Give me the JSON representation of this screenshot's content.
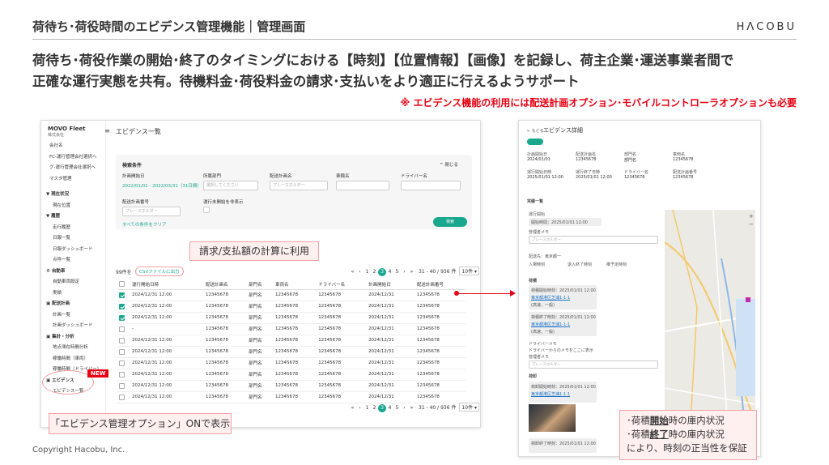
{
  "slide": {
    "title": "荷待ち･荷役時間のエビデンス管理機能｜管理画面",
    "logo": "HΛCOBU",
    "headline_line1": "荷待ち･荷役作業の開始･終了のタイミングにおける【時刻】【位置情報】【画像】を記録し、荷主企業･運送事業者間で",
    "headline_line2": "正確な運行実態を共有。待機料金･荷役料金の請求･支払いをより適正に行えるようサポート",
    "note": "※ エビデンス機能の利用には配送計画オプション･モバイルコントローラオプションも必要",
    "copyright": "Copyright Hacobu, Inc."
  },
  "app": {
    "brand": "MOVO Fleet",
    "brand_sub": "株式会社",
    "page_title": "エビデンス一覧",
    "sidebar": [
      {
        "label": "会社名",
        "kind": "item"
      },
      {
        "label": "FC-運行管理会社選択へ",
        "kind": "item"
      },
      {
        "label": "グ-運行管理会社選択へ",
        "kind": "item"
      },
      {
        "label": "マスタ管理",
        "kind": "item"
      },
      {
        "label": "",
        "kind": "gap"
      },
      {
        "label": "▼ 現在状況",
        "kind": "sec"
      },
      {
        "label": "現在位置",
        "kind": "sub"
      },
      {
        "label": "▼ 履歴",
        "kind": "sec"
      },
      {
        "label": "走行履歴",
        "kind": "sub"
      },
      {
        "label": "日報一覧",
        "kind": "sub"
      },
      {
        "label": "日報ダッシュボード",
        "kind": "sub"
      },
      {
        "label": "点呼一覧",
        "kind": "sub"
      },
      {
        "label": "⚙ 自動車",
        "kind": "sec"
      },
      {
        "label": "自動車両設定",
        "kind": "sub"
      },
      {
        "label": "実績",
        "kind": "sub"
      },
      {
        "label": "▣ 配送計画",
        "kind": "sec"
      },
      {
        "label": "計画一覧",
        "kind": "sub"
      },
      {
        "label": "計画ダッシュボード",
        "kind": "sub"
      },
      {
        "label": "▣ 集計・分析",
        "kind": "sec"
      },
      {
        "label": "地点滞在時間分析",
        "kind": "sub"
      },
      {
        "label": "稼働時間（車両）",
        "kind": "sub"
      },
      {
        "label": "稼働時間（ドライバー）",
        "kind": "sub"
      },
      {
        "label": "▣ エビデンス",
        "kind": "sec"
      },
      {
        "label": "エビデンス一覧",
        "kind": "sub"
      }
    ],
    "filter": {
      "heading": "検索条件",
      "close_label": "^ 閉じる",
      "labels": {
        "period": "計画開始日",
        "dept": "所属部門",
        "plan": "配送計画名",
        "vehicle": "車輌名",
        "driver": "ドライバー名",
        "plan_no": "配送計画番号",
        "hide": "運行未開始を非表示"
      },
      "period_value": "2022/01/01 - 2022/03/31（31日間）",
      "dept_placeholder": "選択してください",
      "plan_placeholder": "プレースホルダー",
      "plan_no_placeholder": "プレースホルダー",
      "clear_label": "すべての条件をクリア",
      "search_button": "検索"
    },
    "count": "99件を",
    "csv_label": "CSVファイルに出力",
    "pager": {
      "pages": [
        "«",
        "‹",
        "1",
        "2",
        "3",
        "4",
        "5",
        "›",
        "»"
      ],
      "current": "3",
      "range": "31 - 40 / 936 件",
      "per_page": "10件 ▾"
    },
    "table": {
      "headers": [
        "",
        "運行開始日時",
        "配送計画名",
        "部門名",
        "車両名",
        "ドライバー名",
        "計画開始日",
        "配送計画番号"
      ],
      "rows": [
        {
          "checked": true,
          "cells": [
            "2024/12/31 12:00",
            "12345678",
            "部門名",
            "12345678",
            "12345678",
            "2024/12/31",
            "12345678"
          ]
        },
        {
          "checked": true,
          "cells": [
            "2024/12/31 12:00",
            "12345678",
            "部門名",
            "12345678",
            "12345678",
            "2024/12/31",
            "12345678"
          ]
        },
        {
          "checked": true,
          "cells": [
            "2024/12/31 12:00",
            "12345678",
            "部門名",
            "12345678",
            "12345678",
            "2024/12/31",
            "12345678"
          ]
        },
        {
          "checked": false,
          "cells": [
            "-",
            "12345678",
            "部門名",
            "12345678",
            "12345678",
            "2024/12/31",
            "12345678"
          ]
        },
        {
          "checked": false,
          "cells": [
            "2024/12/31 12:00",
            "12345678",
            "部門名",
            "12345678",
            "12345678",
            "2024/12/31",
            "12345678"
          ]
        },
        {
          "checked": false,
          "cells": [
            "2024/12/31 12:00",
            "12345678",
            "部門名",
            "12345678",
            "12345678",
            "2024/12/31",
            "12345678"
          ]
        },
        {
          "checked": false,
          "cells": [
            "2024/12/31 12:00",
            "12345678",
            "部門名",
            "12345678",
            "12345678",
            "2024/12/31",
            "12345678"
          ]
        },
        {
          "checked": false,
          "cells": [
            "2024/12/31 12:00",
            "12345678",
            "部門名",
            "12345678",
            "12345678",
            "2024/12/31",
            "12345678"
          ]
        },
        {
          "checked": false,
          "cells": [
            "2024/12/31 12:00",
            "12345678",
            "部門名",
            "12345678",
            "12345678",
            "2024/12/31",
            "12345678"
          ]
        },
        {
          "checked": false,
          "cells": [
            "2024/12/31 12:00",
            "12345678",
            "部門名",
            "12345678",
            "12345678",
            "2024/12/31",
            "12345678"
          ]
        }
      ]
    }
  },
  "callouts": {
    "billing": "請求/支払額の計算に利用",
    "option": "「エビデンス管理オプション」ONで表示",
    "new_badge": "NEW",
    "evidence_line1a": "･荷積",
    "evidence_line1b": "開始",
    "evidence_line1c": "時の庫内状況",
    "evidence_line2a": "･荷積",
    "evidence_line2b": "終了",
    "evidence_line2c": "時の庫内状況",
    "evidence_line3": "により、時刻の正当性を保証"
  },
  "detail": {
    "breadcrumb": "← もどる",
    "title": "エビデンス詳細",
    "fields": [
      {
        "label": "計画開始日",
        "value": "2024/01/01"
      },
      {
        "label": "配送計画名",
        "value": "12345678"
      },
      {
        "label": "部門名",
        "value": "部門名"
      },
      {
        "label": "車両名",
        "value": "12345678"
      },
      {
        "label": "運行開始日時",
        "value": "2025/01/01 12:00"
      },
      {
        "label": "運行終了日時",
        "value": "2025/01/01 12:00"
      },
      {
        "label": "ドライバー名",
        "value": "12345678"
      },
      {
        "label": "配送計画番号",
        "value": "12345678"
      }
    ],
    "section": "実績一覧",
    "op_start": "運行開始",
    "start_time": "開始時間：2025/01/01 12:00",
    "memo_label": "管理者メモ",
    "memo_placeholder": "プレースホルダー",
    "stop_label": "配送先：東京都一",
    "stop_fields": [
      "入場時刻",
      "退入終了時刻",
      "推予定時刻"
    ],
    "loading": "荷積",
    "card1": "荷積開始時刻：2025/01/01 12:00",
    "card2": "荷積終了時刻：2025/01/01 12:00",
    "link": "東京都港区芝浦1-1-1",
    "pill": "(高速、一般)",
    "driver_memo": "ドライバーメモ",
    "driver_memo_text": "ドライバーからのメモをここに表示",
    "unloading": "荷卸",
    "card3": "荷卸開始時刻：2025/01/01 12:00",
    "card4": "荷卸終了時刻：2025/01/01 12:00"
  }
}
